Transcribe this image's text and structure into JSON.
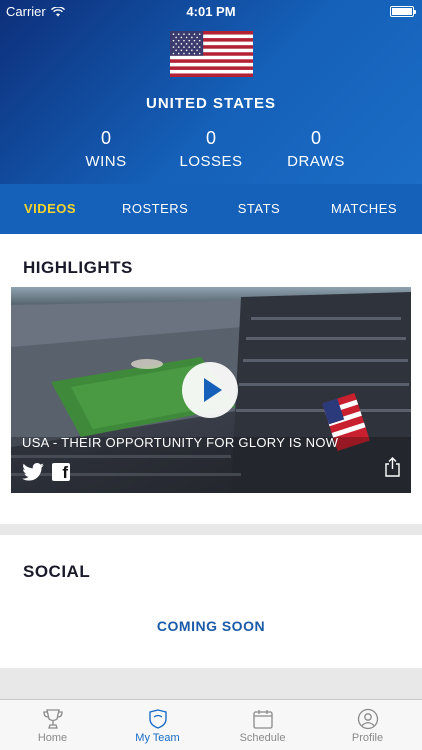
{
  "status_bar": {
    "carrier": "Carrier",
    "time": "4:01 PM"
  },
  "team": {
    "name": "UNITED STATES",
    "stats": [
      {
        "value": "0",
        "label": "WINS"
      },
      {
        "value": "0",
        "label": "LOSSES"
      },
      {
        "value": "0",
        "label": "DRAWS"
      }
    ]
  },
  "tabs": [
    {
      "label": "VIDEOS",
      "active": true
    },
    {
      "label": "ROSTERS",
      "active": false
    },
    {
      "label": "STATS",
      "active": false
    },
    {
      "label": "MATCHES",
      "active": false
    }
  ],
  "highlights": {
    "title": "HIGHLIGHTS",
    "video_title": "USA - THEIR OPPORTUNITY FOR GLORY IS NOW"
  },
  "social": {
    "title": "SOCIAL",
    "message": "COMING SOON"
  },
  "tabbar": [
    {
      "label": "Home",
      "icon": "trophy-icon",
      "active": false
    },
    {
      "label": "My Team",
      "icon": "shield-icon",
      "active": true
    },
    {
      "label": "Schedule",
      "icon": "calendar-icon",
      "active": false
    },
    {
      "label": "Profile",
      "icon": "person-icon",
      "active": false
    }
  ],
  "colors": {
    "primary": "#1560b8",
    "active_tab": "#f5d42d",
    "link": "#1a5aa8"
  }
}
